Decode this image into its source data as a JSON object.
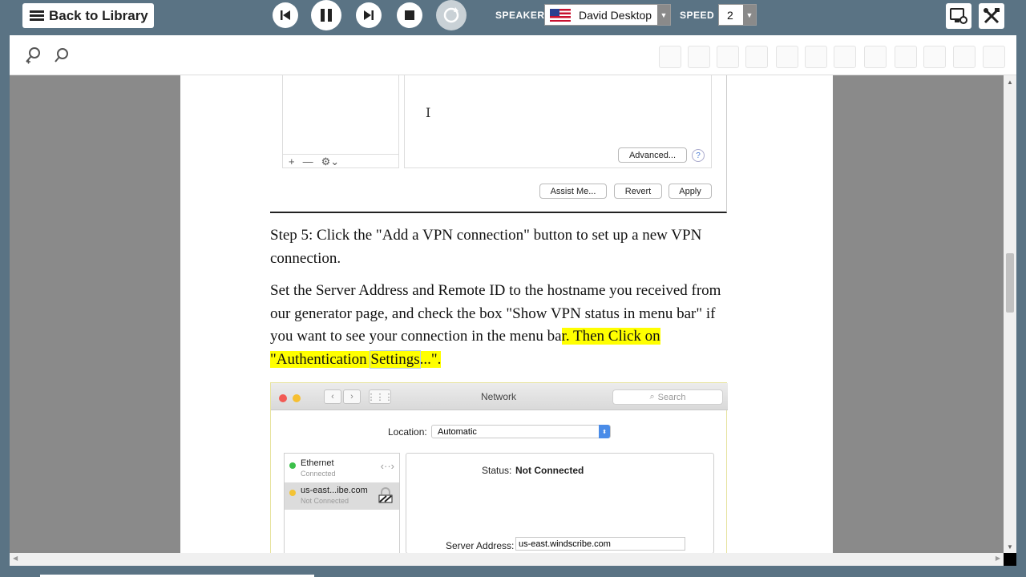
{
  "topbar": {
    "back_label": "Back to Library",
    "speaker_label": "SPEAKER",
    "speaker_value": "David Desktop",
    "speed_label": "SPEED",
    "speed_value": "2"
  },
  "document": {
    "screenshot1": {
      "advanced_label": "Advanced...",
      "help_glyph": "?",
      "assist_label": "Assist Me...",
      "revert_label": "Revert",
      "apply_label": "Apply",
      "list_controls": [
        "+",
        "—",
        "⚙︎⌄"
      ]
    },
    "step5": {
      "line1": "Step 5: Click the \"Add a VPN connection\" button to set up a new VPN",
      "line2": "connection."
    },
    "para2": {
      "line1": "Set the Server Address and Remote ID to the hostname you received from",
      "line2": "our generator page, and check the box \"Show VPN status in menu bar\" if",
      "line3_plain": "you want to see your connection in the menu ba",
      "line3_hl": "r. Then Click on",
      "line4_a": "\"Authentication ",
      "line4_b": "Settings",
      "line4_c": "...\"."
    },
    "screenshot2": {
      "window_title": "Network",
      "search_placeholder": "Search",
      "location_label": "Location:",
      "location_value": "Automatic",
      "services": [
        {
          "name": "Ethernet",
          "status": "Connected",
          "dot_color": "#3cc04a"
        },
        {
          "name": "us-east...ibe.com",
          "status": "Not Connected",
          "dot_color": "#f3c335"
        }
      ],
      "status_label": "Status:",
      "status_value": "Not Connected",
      "server_label": "Server Address:",
      "server_value": "us-east.windscribe.com"
    }
  }
}
